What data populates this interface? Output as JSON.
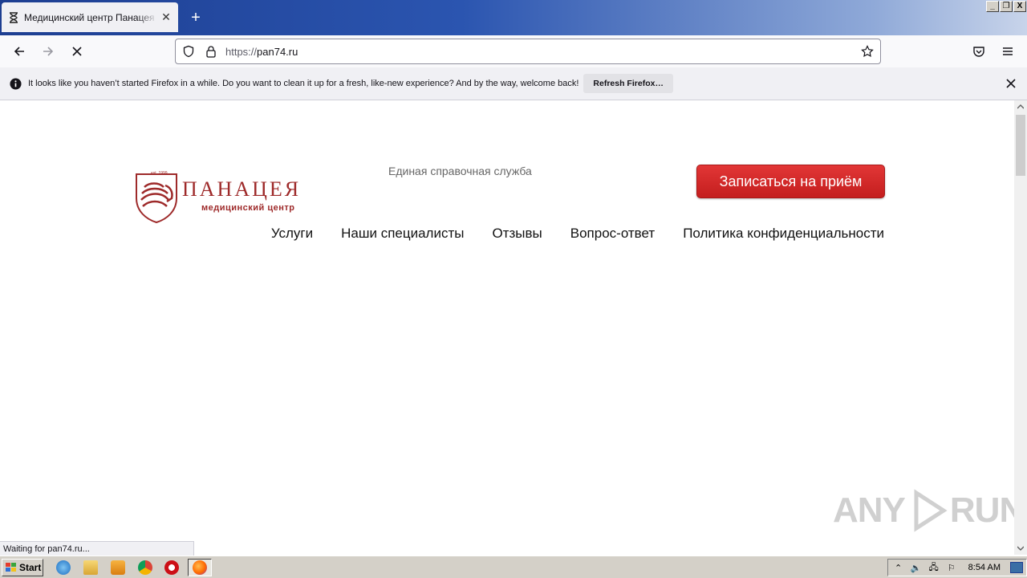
{
  "browser": {
    "tab_title": "Медицинский центр Панацея в Челябинске",
    "url_scheme": "https://",
    "url_host": "pan74.ru",
    "status_text": "Waiting for pan74.ru...",
    "window_controls": [
      "_",
      "❐",
      "X"
    ]
  },
  "notification": {
    "message": "It looks like you haven’t started Firefox in a while. Do you want to clean it up for a fresh, like-new experience? And by the way, welcome back!",
    "button_label": "Refresh Firefox…"
  },
  "site": {
    "logo_name": "ПАНАЦЕЯ",
    "logo_subtitle": "медицинский центр",
    "logo_est": "est. 1999",
    "hotline_label": "Единая справочная служба",
    "cta_label": "Записаться на приём",
    "menu": [
      {
        "label": "Услуги"
      },
      {
        "label": "Наши специалисты"
      },
      {
        "label": "Отзывы"
      },
      {
        "label": "Вопрос-ответ"
      },
      {
        "label": "Политика конфиденциальности"
      }
    ],
    "brand_color": "#9e2a2a",
    "cta_color": "#d62828"
  },
  "watermark": {
    "left": "ANY",
    "right": "RUN"
  },
  "taskbar": {
    "start_label": "Start",
    "clock": "8:54 AM"
  }
}
